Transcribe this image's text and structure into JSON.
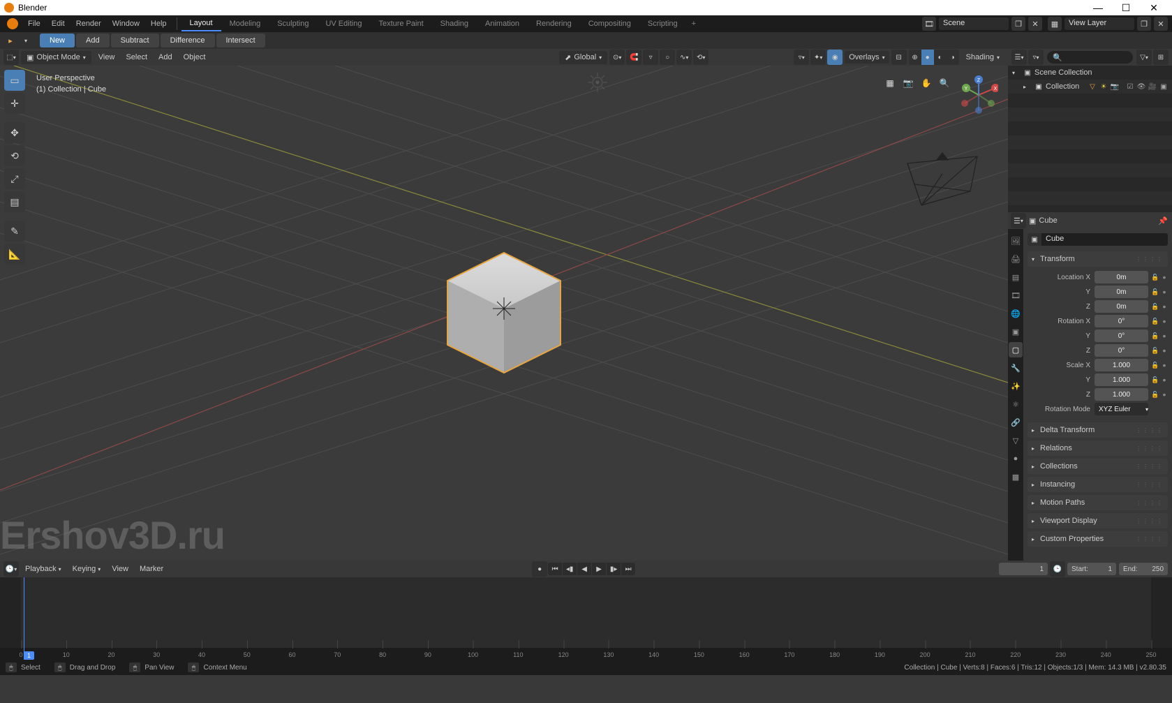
{
  "window": {
    "title": "Blender"
  },
  "menu": {
    "file": "File",
    "edit": "Edit",
    "render": "Render",
    "window": "Window",
    "help": "Help"
  },
  "workspaces": {
    "tabs": [
      "Layout",
      "Modeling",
      "Sculpting",
      "UV Editing",
      "Texture Paint",
      "Shading",
      "Animation",
      "Rendering",
      "Compositing",
      "Scripting"
    ],
    "active": 0
  },
  "sceneField": {
    "label": "Scene"
  },
  "viewLayerField": {
    "label": "View Layer"
  },
  "toolHeader": {
    "buttons": [
      "New",
      "Add",
      "Subtract",
      "Difference",
      "Intersect"
    ],
    "active": 0
  },
  "view3d": {
    "modeLabel": "Object Mode",
    "menus": {
      "view": "View",
      "select": "Select",
      "add": "Add",
      "object": "Object"
    },
    "orient": "Global",
    "overlaysLabel": "Overlays",
    "shadingLabel": "Shading",
    "info": {
      "line1": "User Perspective",
      "line2": "(1) Collection | Cube"
    },
    "watermark": "Ershov3D.ru"
  },
  "outliner": {
    "root": "Scene Collection",
    "collection": "Collection"
  },
  "properties": {
    "breadcrumb": "Cube",
    "nameField": "Cube",
    "transform": {
      "title": "Transform",
      "loc": {
        "label": "Location X",
        "x": "0m",
        "y": "0m",
        "z": "0m",
        "yl": "Y",
        "zl": "Z"
      },
      "rot": {
        "label": "Rotation X",
        "x": "0°",
        "y": "0°",
        "z": "0°",
        "yl": "Y",
        "zl": "Z"
      },
      "scl": {
        "label": "Scale X",
        "x": "1.000",
        "y": "1.000",
        "z": "1.000",
        "yl": "Y",
        "zl": "Z"
      },
      "mode": {
        "label": "Rotation Mode",
        "value": "XYZ Euler"
      }
    },
    "sections": [
      "Delta Transform",
      "Relations",
      "Collections",
      "Instancing",
      "Motion Paths",
      "Viewport Display",
      "Custom Properties"
    ]
  },
  "timeline": {
    "menus": {
      "playback": "Playback",
      "keying": "Keying",
      "view": "View",
      "marker": "Marker"
    },
    "current": 1,
    "start": 1,
    "end": 250,
    "startLabel": "Start:",
    "endLabel": "End:",
    "ticks": [
      0,
      10,
      20,
      30,
      40,
      50,
      60,
      70,
      80,
      90,
      100,
      110,
      120,
      130,
      140,
      150,
      160,
      170,
      180,
      190,
      200,
      210,
      220,
      230,
      240,
      250
    ]
  },
  "status": {
    "hints": {
      "select": "Select",
      "drag": "Drag and Drop",
      "pan": "Pan View",
      "menu": "Context Menu"
    },
    "right": "Collection | Cube | Verts:8 | Faces:6 | Tris:12 | Objects:1/3 | Mem: 14.3 MB | v2.80.35"
  }
}
